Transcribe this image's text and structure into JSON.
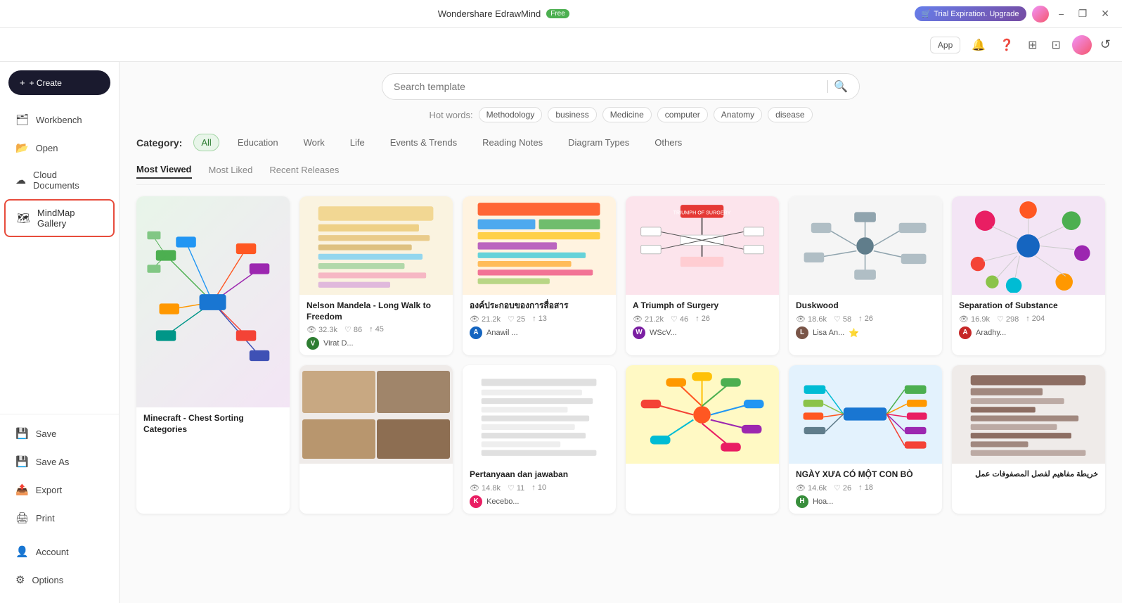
{
  "titlebar": {
    "app_name": "Wondershare EdrawMind",
    "badge": "Free",
    "trial_label": "Trial Expiration. Upgrade",
    "toolbar_app_label": "App",
    "win_min": "−",
    "win_restore": "❐",
    "win_close": "✕"
  },
  "toolbar": {
    "app_label": "App"
  },
  "sidebar": {
    "create_label": "+ Create",
    "items": [
      {
        "id": "workbench",
        "label": "Workbench",
        "icon": "🗂"
      },
      {
        "id": "open",
        "label": "Open",
        "icon": "📂"
      },
      {
        "id": "cloud",
        "label": "Cloud Documents",
        "icon": "☁"
      },
      {
        "id": "mindmap-gallery",
        "label": "MindMap Gallery",
        "icon": "🗺",
        "active": true
      }
    ],
    "bottom_items": [
      {
        "id": "save",
        "label": "Save",
        "icon": "💾"
      },
      {
        "id": "save-as",
        "label": "Save As",
        "icon": "💾"
      },
      {
        "id": "export",
        "label": "Export",
        "icon": "📤"
      },
      {
        "id": "print",
        "label": "Print",
        "icon": "🖨"
      }
    ],
    "footer_items": [
      {
        "id": "account",
        "label": "Account",
        "icon": "👤"
      },
      {
        "id": "options",
        "label": "Options",
        "icon": "⚙"
      }
    ]
  },
  "search": {
    "placeholder": "Search template",
    "hot_label": "Hot words:",
    "hot_tags": [
      "Methodology",
      "business",
      "Medicine",
      "computer",
      "Anatomy",
      "disease"
    ]
  },
  "category": {
    "label": "Category:",
    "items": [
      {
        "id": "all",
        "label": "All",
        "active": true
      },
      {
        "id": "education",
        "label": "Education"
      },
      {
        "id": "work",
        "label": "Work"
      },
      {
        "id": "life",
        "label": "Life"
      },
      {
        "id": "events",
        "label": "Events & Trends"
      },
      {
        "id": "reading",
        "label": "Reading Notes"
      },
      {
        "id": "diagram",
        "label": "Diagram Types"
      },
      {
        "id": "others",
        "label": "Others"
      }
    ]
  },
  "tabs": [
    {
      "id": "most-viewed",
      "label": "Most Viewed",
      "active": true
    },
    {
      "id": "most-liked",
      "label": "Most Liked"
    },
    {
      "id": "recent",
      "label": "Recent Releases"
    }
  ],
  "cards": [
    {
      "id": "card1",
      "title": "",
      "span2": true,
      "color_scheme": "multicolor_tree",
      "views": "",
      "likes": "",
      "comments": "",
      "author": "",
      "author_color": "#888",
      "subtitle": "Minecraft - Chest Sorting Categories"
    },
    {
      "id": "card2",
      "title": "Nelson Mandela - Long Walk to Freedom",
      "color_scheme": "beige_notes",
      "views": "32.3k",
      "likes": "86",
      "comments": "45",
      "author": "Virat D...",
      "author_color": "#2e7d32",
      "author_letter": "V"
    },
    {
      "id": "card3",
      "title": "องค์ประกอบของการสื่อสาร",
      "color_scheme": "colorful_bars",
      "views": "21.2k",
      "likes": "25",
      "comments": "13",
      "author": "Anawil ...",
      "author_color": "#1565c0",
      "author_letter": "A"
    },
    {
      "id": "card4",
      "title": "A Triumph of Surgery",
      "color_scheme": "surgery_tree",
      "views": "21.2k",
      "likes": "46",
      "comments": "26",
      "author": "WScV...",
      "author_color": "#7b1fa2",
      "author_letter": "W"
    },
    {
      "id": "card5",
      "title": "Duskwood",
      "color_scheme": "gray_tree",
      "views": "18.6k",
      "likes": "58",
      "comments": "26",
      "author": "Lisa An...",
      "author_color": "#795548",
      "author_letter": "L",
      "gold_star": true
    },
    {
      "id": "card6",
      "title": "Separation of Substance",
      "color_scheme": "colorful_circles",
      "views": "16.9k",
      "likes": "298",
      "comments": "204",
      "author": "Aradhy...",
      "author_color": "#c62828",
      "author_letter": "A"
    },
    {
      "id": "card7",
      "title": "",
      "span2": false,
      "color_scheme": "historical_photos",
      "views": "",
      "likes": "",
      "comments": "",
      "author": "",
      "subtitle": ""
    },
    {
      "id": "card8",
      "title": "Pertanyaan dan jawaban",
      "color_scheme": "white_lines",
      "views": "14.8k",
      "likes": "11",
      "comments": "10",
      "author": "Kecebo...",
      "author_color": "#e91e63",
      "author_letter": "K"
    },
    {
      "id": "card9",
      "title": "",
      "color_scheme": "colorful_radial",
      "views": "",
      "subtitle": ""
    },
    {
      "id": "card10",
      "title": "NGÀY XƯA CÓ MỘT CON BÒ",
      "color_scheme": "colored_branches",
      "views": "14.6k",
      "likes": "26",
      "comments": "18",
      "author": "Hoa...",
      "author_color": "#388e3c",
      "author_letter": "H"
    },
    {
      "id": "card11",
      "title": "خريطة مفاهيم لفصل المصفوفات عمل",
      "color_scheme": "brown_map",
      "views": "",
      "likes": "",
      "comments": "",
      "author": ""
    }
  ]
}
